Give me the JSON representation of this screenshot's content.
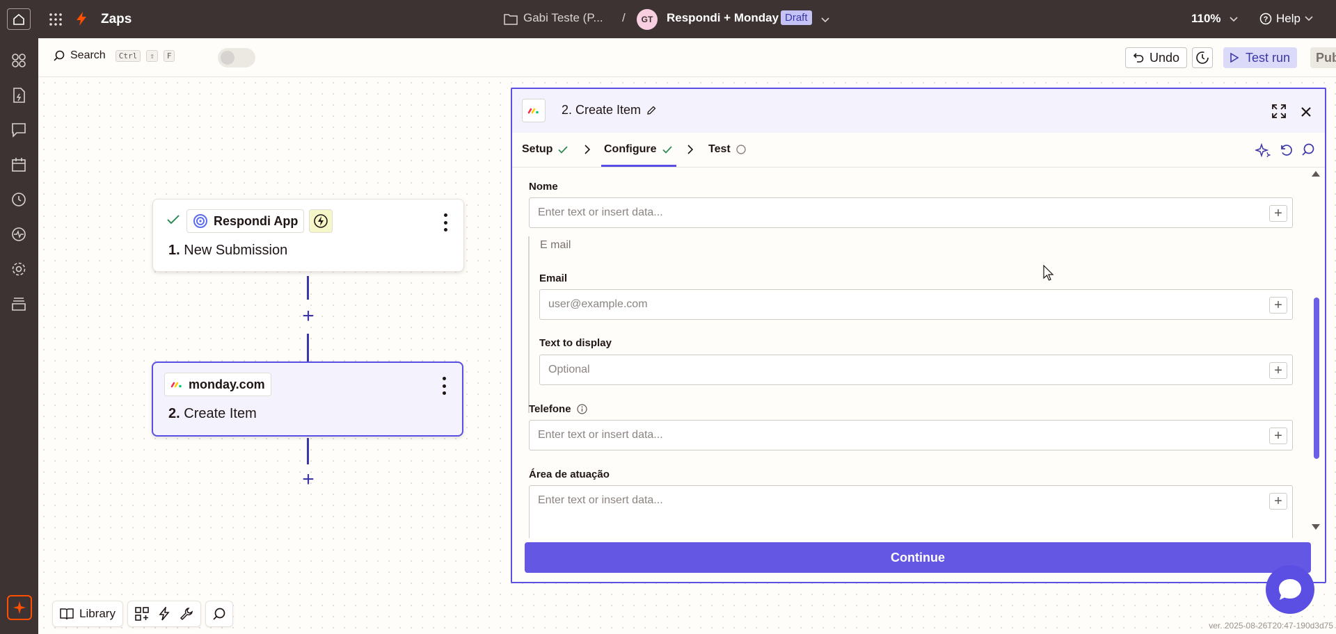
{
  "topbar": {
    "app_name": "Zaps",
    "folder": "Gabi Teste (P...",
    "separator": "/",
    "owner_initials": "GT",
    "zap_name": "Respondi + Monday",
    "status": "Draft",
    "zoom": "110%",
    "help_label": "Help"
  },
  "toolbar": {
    "search_label": "Search",
    "shortcut_ctrl": "Ctrl",
    "shortcut_shift": "⇧",
    "shortcut_f": "F",
    "undo_label": "Undo",
    "test_run_label": "Test run",
    "publish_label": "Publish"
  },
  "canvas": {
    "step1": {
      "app": "Respondi App",
      "number": "1.",
      "title": "New Submission"
    },
    "step2": {
      "app": "monday.com",
      "number": "2.",
      "title": "Create Item"
    }
  },
  "bottombar": {
    "library_label": "Library"
  },
  "version": "ver. 2025-08-26T20:47-190d3d75",
  "panel": {
    "title": "2. Create Item",
    "tabs": [
      {
        "label": "Setup",
        "state": "complete"
      },
      {
        "label": "Configure",
        "state": "complete"
      },
      {
        "label": "Test",
        "state": "pending"
      }
    ],
    "fields": {
      "nome": {
        "label": "Nome",
        "placeholder": "Enter text or insert data..."
      },
      "email_group_title": "E mail",
      "email": {
        "label": "Email",
        "placeholder": "user@example.com"
      },
      "text_to_display": {
        "label": "Text to display",
        "placeholder": "Optional"
      },
      "telefone": {
        "label": "Telefone",
        "placeholder": "Enter text or insert data..."
      },
      "area": {
        "label": "Área de atuação",
        "placeholder": "Enter text or insert data..."
      }
    },
    "continue_label": "Continue"
  },
  "colors": {
    "topbar_bg": "#3d3332",
    "accent": "#5a4ee3",
    "brand_orange": "#ff4f00",
    "check_green": "#2e8b57"
  }
}
